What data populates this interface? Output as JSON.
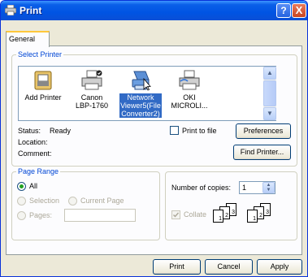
{
  "window": {
    "title": "Print",
    "help": "?",
    "close": "X"
  },
  "tab": {
    "label": "General"
  },
  "select_printer": {
    "legend": "Select Printer",
    "printers": [
      {
        "label": "Add Printer"
      },
      {
        "label": "Canon\nLBP-1760"
      },
      {
        "label": "Network\nViewer5(File\nConverter2)",
        "selected": true
      },
      {
        "label": "OKI\nMICROLI..."
      }
    ],
    "status_label": "Status:",
    "status_value": "Ready",
    "location_label": "Location:",
    "comment_label": "Comment:",
    "print_to_file": "Print to file",
    "preferences": "Preferences",
    "find_printer": "Find Printer..."
  },
  "page_range": {
    "legend": "Page Range",
    "all": "All",
    "selection": "Selection",
    "current_page": "Current Page",
    "pages": "Pages:"
  },
  "copies": {
    "label": "Number of copies:",
    "value": "1",
    "collate": "Collate",
    "page_numbers": [
      "1",
      "2",
      "3",
      "1",
      "2",
      "3"
    ]
  },
  "footer": {
    "print": "Print",
    "cancel": "Cancel",
    "apply": "Apply"
  }
}
